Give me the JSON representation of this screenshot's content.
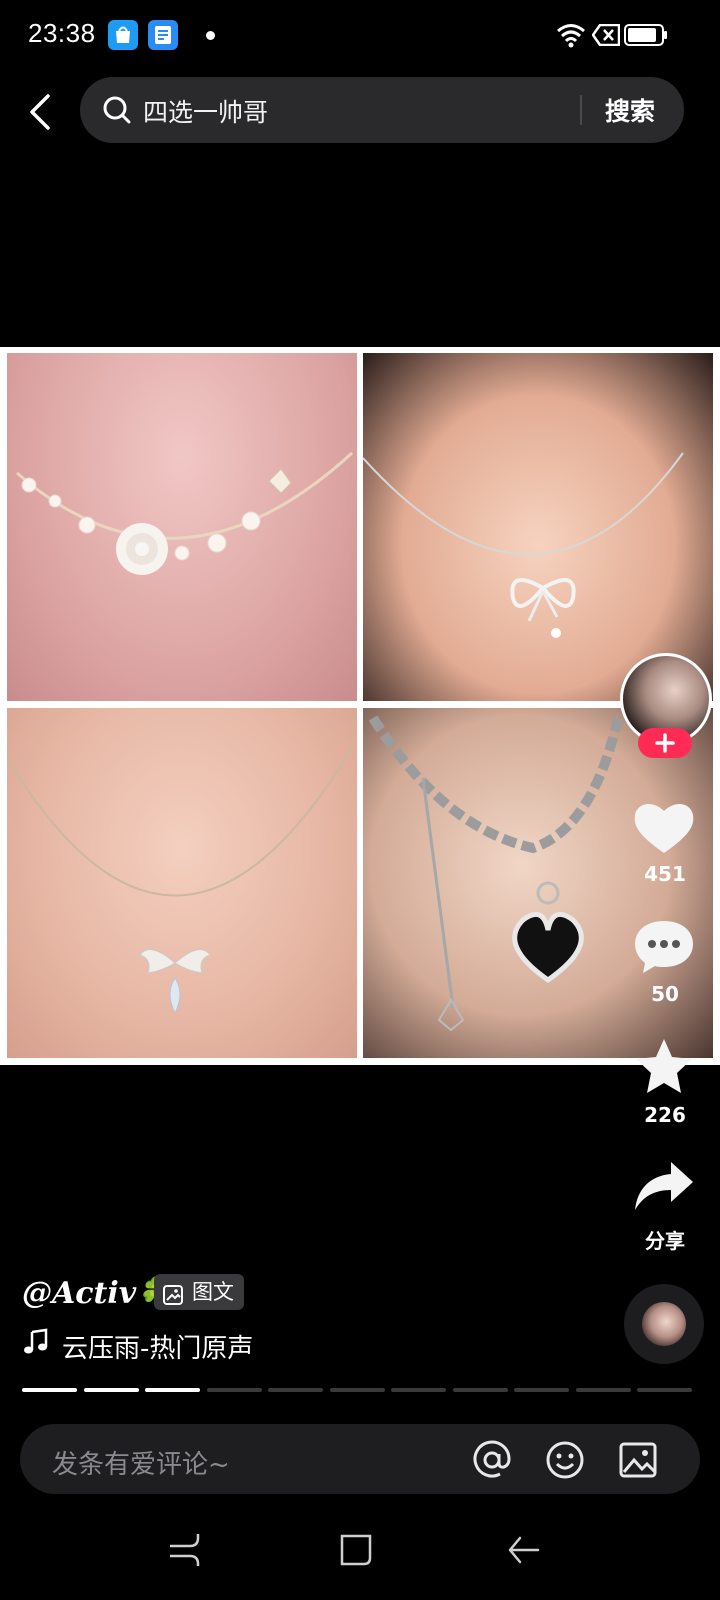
{
  "status_bar": {
    "time": "23:38"
  },
  "search": {
    "query": "四选一帅哥",
    "button": "搜索"
  },
  "actions": {
    "likes": "451",
    "comments": "50",
    "favorites": "226",
    "share": "分享"
  },
  "post": {
    "author": "@Activ🍀",
    "tag": "图文",
    "music": "云压雨-热门原声"
  },
  "progress": {
    "total": 11,
    "current": 3
  },
  "comment": {
    "placeholder": "发条有爱评论~"
  },
  "icons": [
    "back-icon",
    "search-icon",
    "heart-icon",
    "comment-icon",
    "star-icon",
    "share-icon",
    "music-icon",
    "at-icon",
    "emoji-icon",
    "image-icon",
    "image-tag-icon"
  ],
  "colors": {
    "accent": "#fe2c55",
    "background": "#000000",
    "search_bg": "#2a2a2c"
  }
}
